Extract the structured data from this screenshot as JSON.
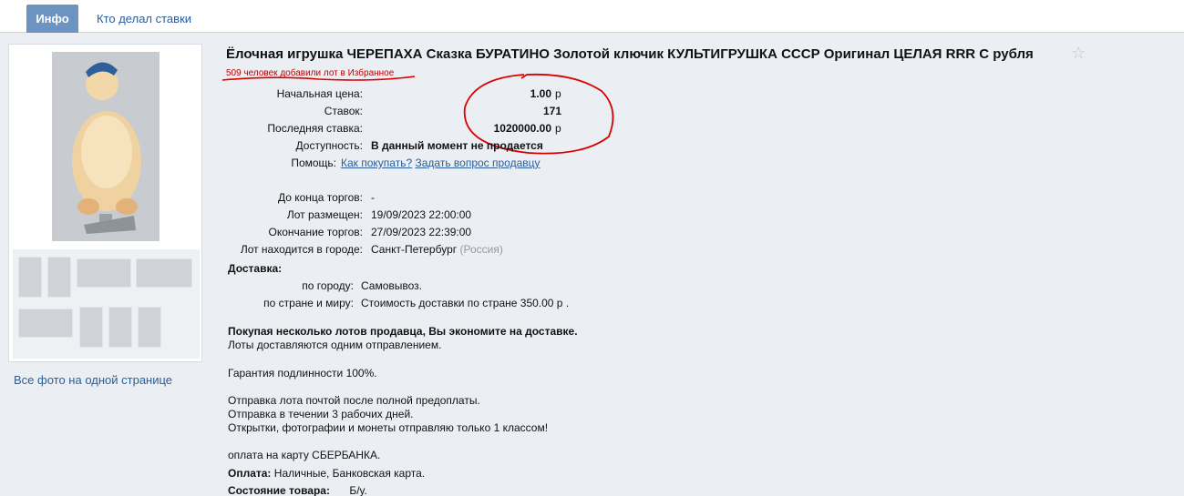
{
  "tabs": [
    {
      "label": "Инфо",
      "active": true
    },
    {
      "label": "Кто делал ставки",
      "active": false
    }
  ],
  "lot": {
    "title": "Ёлочная игрушка ЧЕРЕПАХА Сказка БУРАТИНО Золотой ключик КУЛЬТИГРУШКА СССР Оригинал ЦЕЛАЯ RRR С рубля",
    "favorites": "509 человек добавили лот в Избранное"
  },
  "price": {
    "start_label": "Начальная цена:",
    "start_value": "1.00",
    "bids_label": "Ставок:",
    "bids_value": "171",
    "last_label": "Последняя ставка:",
    "last_value": "1020000.00",
    "currency": "р",
    "avail_label": "Доступность:",
    "avail_value": "В данный момент не продается",
    "help_label": "Помощь:",
    "help_link1": "Как покупать?",
    "help_link2": "Задать вопрос продавцу"
  },
  "timing": {
    "end_label": "До конца торгов:",
    "end_value": "-",
    "placed_label": "Лот размещен:",
    "placed_value": "19/09/2023 22:00:00",
    "finish_label": "Окончание торгов:",
    "finish_value": "27/09/2023 22:39:00",
    "city_label": "Лот находится в городе:",
    "city_value": "Санкт-Петербург",
    "country_value": "(Россия)"
  },
  "delivery": {
    "heading": "Доставка:",
    "city_label": "по городу:",
    "city_value": "Самовывоз.",
    "world_label": "по стране и миру:",
    "world_value": "Стоимость доставки по стране 350.00 р ."
  },
  "description": {
    "save_note": "Покупая несколько лотов продавца, Вы экономите на доставке.",
    "one_shipment": "Лоты доставляются одним отправлением.",
    "guarantee": "Гарантия подлинности 100%.",
    "ship1": "Отправка лота почтой после полной предоплаты.",
    "ship2": "Отправка в течении 3 рабочих дней.",
    "ship3": "Открытки, фотографии и монеты отправляю только 1 классом!",
    "card": "оплата на карту СБЕРБАНКА.",
    "payment_label": "Оплата:",
    "payment_value": "Наличные, Банковская карта.",
    "condition_label": "Состояние товара:",
    "condition_value": "Б/у."
  },
  "photos": {
    "all_link": "Все фото на одной странице",
    "main_icon": "turtle-toy-photo",
    "thumb_count": 8
  },
  "colors": {
    "tab_active": "#6d93c0",
    "link": "#2a5d9a",
    "annotation": "#d80000"
  }
}
